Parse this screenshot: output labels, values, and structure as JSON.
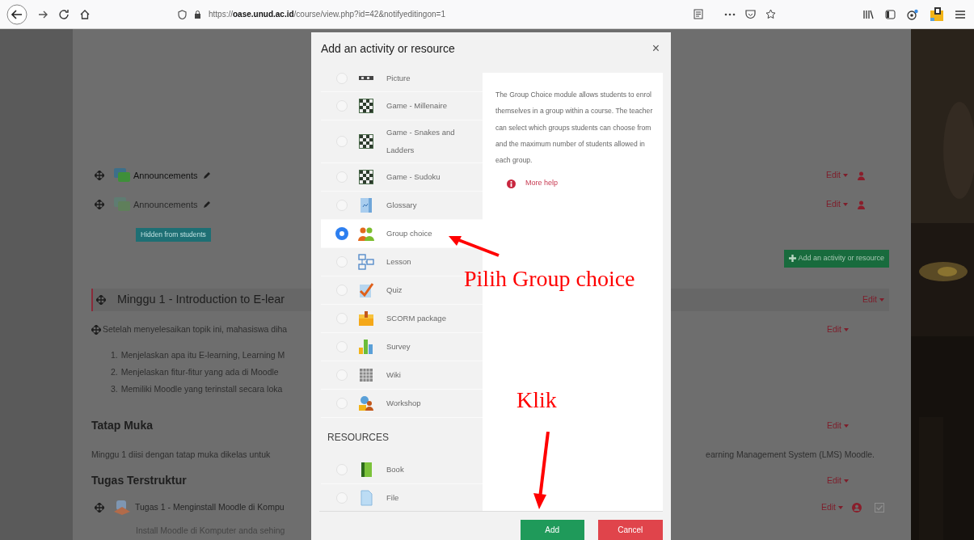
{
  "browser": {
    "url": "https://**oase.unud.ac.id**/course/view.php?id=42&notifyeditingon=1"
  },
  "course": {
    "forums": [
      {
        "title": "Announcements",
        "dimmed": false,
        "edit": "Edit"
      },
      {
        "title": "Announcements",
        "dimmed": true,
        "edit": "Edit",
        "badge": "Hidden from students"
      }
    ],
    "add_button": "Add an activity or resource",
    "section": {
      "title": "Minggu 1 - Introduction to E-lear",
      "edit": "Edit"
    },
    "summary": {
      "text": "Setelah menyelesaikan topik ini, mahasiswa diha",
      "edit": "Edit"
    },
    "objectives": [
      {
        "number": "1.",
        "text": "Menjelaskan apa itu E-learning, Learning M"
      },
      {
        "number": "2.",
        "text": "Menjelaskan fitur-fitur yang ada di Moodle"
      },
      {
        "number": "3.",
        "text": "Memiliki Moodle yang terinstall secara loka"
      }
    ],
    "subsections": [
      {
        "title": "Tatap Muka",
        "edit": "Edit",
        "text_left": "Minggu 1 diisi dengan tatap muka dikelas untuk",
        "text_right": "earning Management System (LMS) Moodle."
      },
      {
        "title": "Tugas Terstruktur",
        "edit": "Edit"
      }
    ],
    "assignment": {
      "title": "Tugas 1 - Menginstall Moodle di Kompu",
      "edit": "Edit",
      "completion_checked": true,
      "description": "Install Moodle di Komputer anda sehing"
    }
  },
  "dialog": {
    "title": "Add an activity or resource",
    "close": "×",
    "activities": [
      {
        "label": "Picture",
        "selected": false
      },
      {
        "label": "Game - Millenaire",
        "selected": false
      },
      {
        "label": "Game - Snakes and Ladders",
        "selected": false
      },
      {
        "label": "Game - Sudoku",
        "selected": false
      },
      {
        "label": "Glossary",
        "selected": false
      },
      {
        "label": "Group choice",
        "selected": true
      },
      {
        "label": "Lesson",
        "selected": false
      },
      {
        "label": "Quiz",
        "selected": false
      },
      {
        "label": "SCORM package",
        "selected": false
      },
      {
        "label": "Survey",
        "selected": false
      },
      {
        "label": "Wiki",
        "selected": false
      },
      {
        "label": "Workshop",
        "selected": false
      }
    ],
    "resources_heading": "RESOURCES",
    "resources": [
      {
        "label": "Book",
        "selected": false
      },
      {
        "label": "File",
        "selected": false
      }
    ],
    "help": {
      "text": "The Group Choice module allows students to enrol themselves in a group within a course. The teacher can select which groups students can choose from and the maximum number of students allowed in each group.",
      "link": "More help"
    },
    "buttons": [
      {
        "label": "Add",
        "kind": "primary"
      },
      {
        "label": "Cancel",
        "kind": "danger"
      }
    ]
  },
  "annotations": [
    {
      "text": "Pilih Group choice"
    },
    {
      "text": "Klik"
    }
  ]
}
